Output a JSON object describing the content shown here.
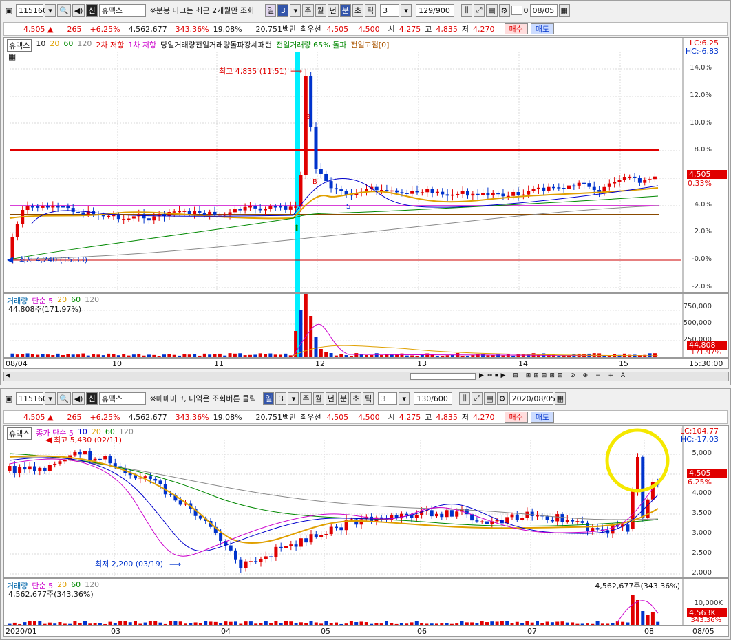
{
  "top": {
    "toolbar": {
      "code": "115160",
      "flag": "신",
      "name": "휴맥스",
      "notice": "※분봉 마크는 최근 2개월만 조회",
      "periods": [
        "일",
        "3",
        "주",
        "월",
        "년",
        "분",
        "초",
        "틱"
      ],
      "sel_period": "분",
      "interval": "3",
      "count": "129/900",
      "check_label": "0",
      "date": "08/05"
    },
    "quote": {
      "price": "4,505",
      "arrow": "▲",
      "change": "265",
      "rate": "+6.25%",
      "volume": "4,562,677",
      "vol_ratio": "343.36%",
      "turnover": "19.08%",
      "amount": "20,751백만",
      "best_label": "최우선",
      "ask": "4,505",
      "bid": "4,500",
      "open_label": "시",
      "open": "4,275",
      "high_label": "고",
      "high": "4,835",
      "low_label": "저",
      "low": "4,270",
      "buy": "매수",
      "sell": "매도"
    },
    "legend": {
      "name": "휴맥스",
      "ma": [
        "10",
        "20",
        "60",
        "120"
      ],
      "r2": "2차 저항",
      "r1": "1차 저항",
      "l3": "당일거래량전일거래량돌파",
      "l4": "강세패턴",
      "l5": "전일거래량 65% 돌파",
      "l6": "전일고점[0]"
    },
    "lc": "LC:6.25",
    "hc": "HC:-6.83",
    "yaxis": [
      "14.0%",
      "12.0%",
      "10.0%",
      "8.0%",
      "6.0%",
      "4.0%",
      "2.0%",
      "-0.0%",
      "-2.0%"
    ],
    "hi_label": "최고 4,835 (11:51)",
    "lo_label": "최저 4,240 (15:33)",
    "price_tag": "4,505",
    "pct_tag": "0.33%",
    "vol_legend": {
      "name": "거래량",
      "ma_label": "단순 5",
      "ma": [
        "20",
        "60",
        "120"
      ],
      "value": "44,808주(171.97%)"
    },
    "vol_axis": [
      "750,000",
      "500,000",
      "250,000"
    ],
    "vol_tag": "44,808",
    "vol_pct": "171.97%",
    "xaxis": [
      "08/04",
      "10",
      "11",
      "12",
      "13",
      "14",
      "15",
      "15:30:00"
    ],
    "marks": {
      "b": "B",
      "s": "S"
    }
  },
  "bottom": {
    "toolbar": {
      "code": "115160",
      "flag": "신",
      "name": "휴맥스",
      "notice": "※매매마크, 내역은 조회버튼 클릭",
      "periods": [
        "일",
        "3",
        "주",
        "월",
        "년",
        "분",
        "초",
        "틱"
      ],
      "sel_period": "일",
      "interval": "3",
      "count": "130/600",
      "date": "2020/08/05"
    },
    "quote": {
      "price": "4,505",
      "arrow": "▲",
      "change": "265",
      "rate": "+6.25%",
      "volume": "4,562,677",
      "vol_ratio": "343.36%",
      "turnover": "19.08%",
      "amount": "20,751백만",
      "best_label": "최우선",
      "ask": "4,505",
      "bid": "4,500",
      "open_label": "시",
      "open": "4,275",
      "high_label": "고",
      "high": "4,835",
      "low_label": "저",
      "low": "4,270",
      "buy": "매수",
      "sell": "매도"
    },
    "legend": {
      "name": "휴맥스",
      "ma_label": "종가 단순 5",
      "ma": [
        "10",
        "20",
        "60",
        "120"
      ]
    },
    "lc": "LC:104.77",
    "hc": "HC:-17.03",
    "yaxis": [
      "5,000",
      "4,500",
      "4,000",
      "3,500",
      "3,000",
      "2,500",
      "2,000"
    ],
    "hi_label": "최고 5,430 (02/11)",
    "lo_label": "최저 2,200 (03/19)",
    "price_tag": "4,505",
    "pct_tag": "6.25%",
    "vol_legend": {
      "name": "거래량",
      "ma_label": "단순 5",
      "ma": [
        "20",
        "60",
        "120"
      ],
      "value": "4,562,677주(343.36%)",
      "peak": "4,562,677주(343.36%)"
    },
    "vol_axis": [
      "10,000K"
    ],
    "vol_tag": "4,563K",
    "vol_pct": "343.36%",
    "xaxis": [
      "2020/01",
      "03",
      "04",
      "05",
      "06",
      "07",
      "08",
      "08/05"
    ]
  },
  "colors": {
    "up": "#e00000",
    "down": "#0033cc",
    "ma5": "#cc00cc",
    "ma10": "#0000cc",
    "ma20": "#e0a000",
    "ma60": "#008800",
    "ma120": "#888888",
    "highlight": "#00f0ff",
    "circle": "#f5e800"
  }
}
